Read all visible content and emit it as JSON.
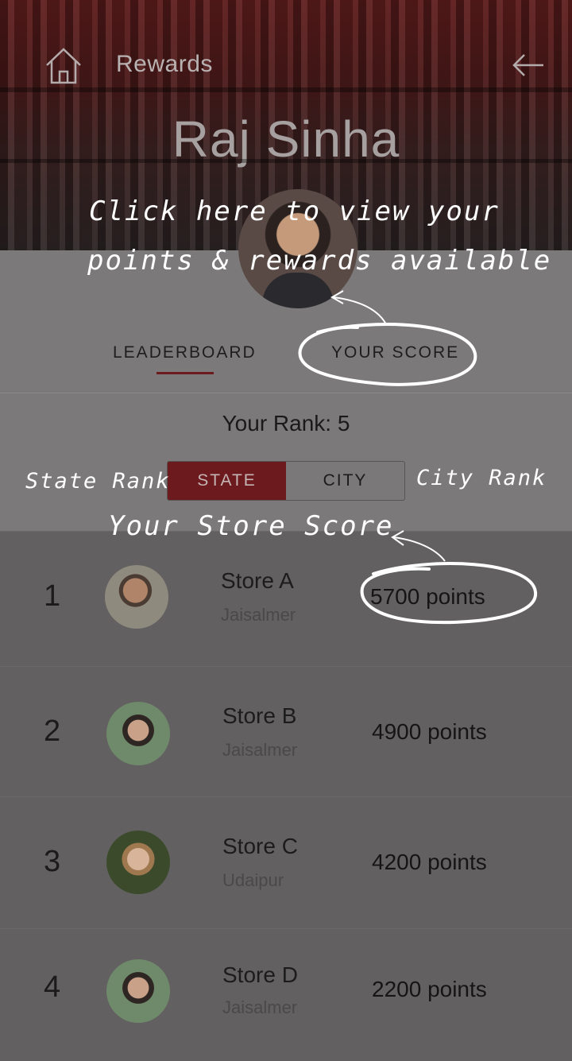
{
  "header": {
    "title": "Rewards",
    "profile_name": "Raj Sinha",
    "home_icon": "home-icon",
    "back_icon": "back-arrow-icon"
  },
  "tabs": [
    {
      "label": "LEADERBOARD",
      "active": true
    },
    {
      "label": "YOUR SCORE",
      "active": false
    }
  ],
  "rank_text": "Your Rank: 5",
  "segment": {
    "state_label": "STATE",
    "city_label": "CITY",
    "selected": "STATE"
  },
  "leaderboard": [
    {
      "rank": "1",
      "store": "Store A",
      "city": "Jaisalmer",
      "points": "5700 points"
    },
    {
      "rank": "2",
      "store": "Store B",
      "city": "Jaisalmer",
      "points": "4900 points"
    },
    {
      "rank": "3",
      "store": "Store C",
      "city": "Udaipur",
      "points": "4200 points"
    },
    {
      "rank": "4",
      "store": "Store D",
      "city": "Jaisalmer",
      "points": "2200 points"
    }
  ],
  "annotations": {
    "view_points_line1": "Click here to view your",
    "view_points_line2": "points & rewards available",
    "state_rank": "State Rank",
    "city_rank": "City Rank",
    "store_score": "Your Store Score"
  },
  "colors": {
    "accent": "#6d1a1e",
    "panel": "#7b7979",
    "row": "#626060"
  }
}
